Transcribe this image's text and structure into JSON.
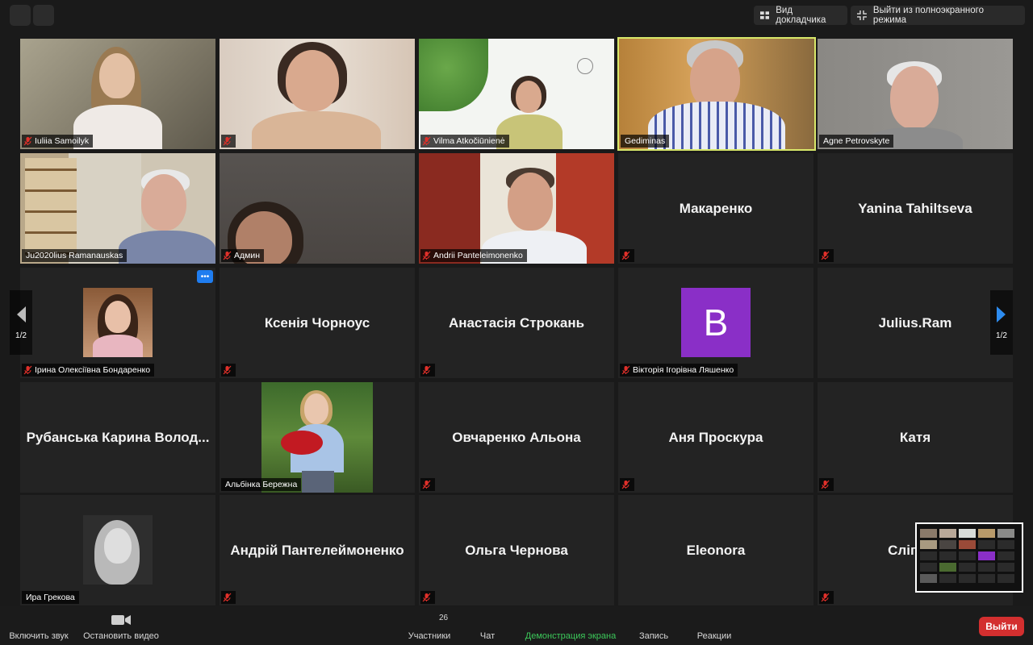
{
  "topbar": {
    "speaker_view_label": "Вид докладчика",
    "exit_fullscreen_label": "Выйти из полноэкранного режима"
  },
  "tiles": {
    "t1": "Iuliia Samoilyk",
    "t3": "Vilma Atkočiūnienė",
    "t4": "Gediminas",
    "t5": "Agne Petrovskyte",
    "t6": "Ju2020lius Ramanauskas",
    "t7": "Админ",
    "t8": "Andrii Panteleimonenko",
    "t9": "Макаренко",
    "t10": "Yanina Tahiltseva",
    "t11": "Ірина Олексіївна Бондаренко",
    "t12": "Ксенія Чорноус",
    "t13": "Анастасія Строкань",
    "t14_avatar": "B",
    "t14": "Вікторія Ігорівна Ляшенко",
    "t15": "Julius.Ram",
    "t16": "Рубанська Карина Волод...",
    "t17": "Альбінка Бережна",
    "t18": "Овчаренко Альона",
    "t19": "Аня Проскура",
    "t20": "Катя",
    "t21": "Ира Грекова",
    "t22": "Андрій Пантелеймоненко",
    "t23": "Ольга Чернова",
    "t24": "Eleonora",
    "t25": "Сліпчен"
  },
  "more_label": "•••",
  "pagination": {
    "left": "1/2",
    "right": "1/2"
  },
  "toolbar": {
    "unmute": "Включить звук",
    "stop_video": "Остановить видео",
    "participants_count": "26",
    "participants": "Участники",
    "chat": "Чат",
    "share_screen": "Демонстрация экрана",
    "record": "Запись",
    "reactions": "Реакции",
    "leave": "Выйти"
  },
  "colors": {
    "active_speaker_border": "#d8e86a",
    "share_screen": "#3cc85a",
    "leave": "#d32f2f",
    "muted_icon": "#e0302a"
  }
}
